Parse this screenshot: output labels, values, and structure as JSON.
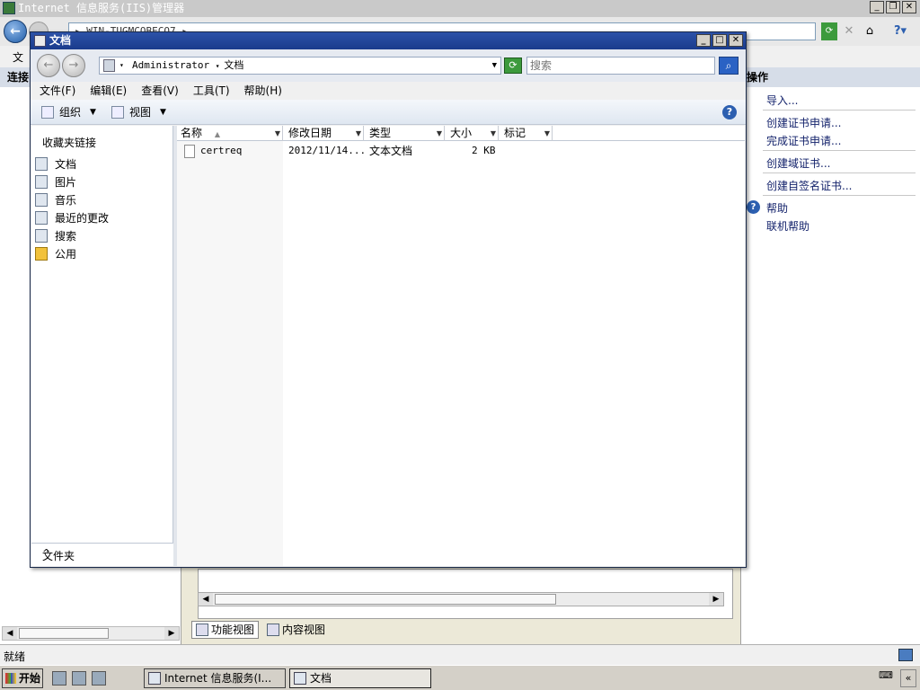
{
  "iis": {
    "title": "Internet 信息服务(IIS)管理器",
    "address": "▸ WIN-TUGMCQBECQ7 ▸",
    "menu_first": "文",
    "left_header": "连接",
    "right_header": "操作",
    "actions": [
      {
        "label": "导入..."
      },
      {
        "label": "创建证书申请..."
      },
      {
        "label": "完成证书申请..."
      },
      {
        "label": "创建域证书..."
      },
      {
        "label": "创建自签名证书..."
      },
      {
        "label": "帮助"
      },
      {
        "label": "联机帮助"
      }
    ],
    "view_tabs": [
      "功能视图",
      "内容视图"
    ],
    "status": "就绪"
  },
  "explorer": {
    "title": "文档",
    "breadcrumb": [
      "Administrator",
      "文档"
    ],
    "search_placeholder": "搜索",
    "menu": [
      "文件(F)",
      "编辑(E)",
      "查看(V)",
      "工具(T)",
      "帮助(H)"
    ],
    "toolbar": {
      "organize": "组织",
      "views": "视图"
    },
    "favorites_title": "收藏夹链接",
    "favorites": [
      {
        "label": "文档",
        "icon": "documents-icon"
      },
      {
        "label": "图片",
        "icon": "pictures-icon"
      },
      {
        "label": "音乐",
        "icon": "music-icon"
      },
      {
        "label": "最近的更改",
        "icon": "recent-icon"
      },
      {
        "label": "搜索",
        "icon": "search-folder-icon"
      },
      {
        "label": "公用",
        "icon": "folder-icon"
      }
    ],
    "folders_label": "文件夹",
    "columns": [
      "名称",
      "修改日期",
      "类型",
      "大小",
      "标记"
    ],
    "files": [
      {
        "name": "certreq",
        "modified": "2012/11/14...",
        "type": "文本文档",
        "size": "2 KB",
        "tags": ""
      }
    ]
  },
  "taskbar": {
    "start": "开始",
    "tasks": [
      "Internet 信息服务(I...",
      "文档"
    ]
  },
  "colors": {
    "title_active": "#1a3b8c",
    "link": "#13226b",
    "accent": "#2c5fb0"
  }
}
